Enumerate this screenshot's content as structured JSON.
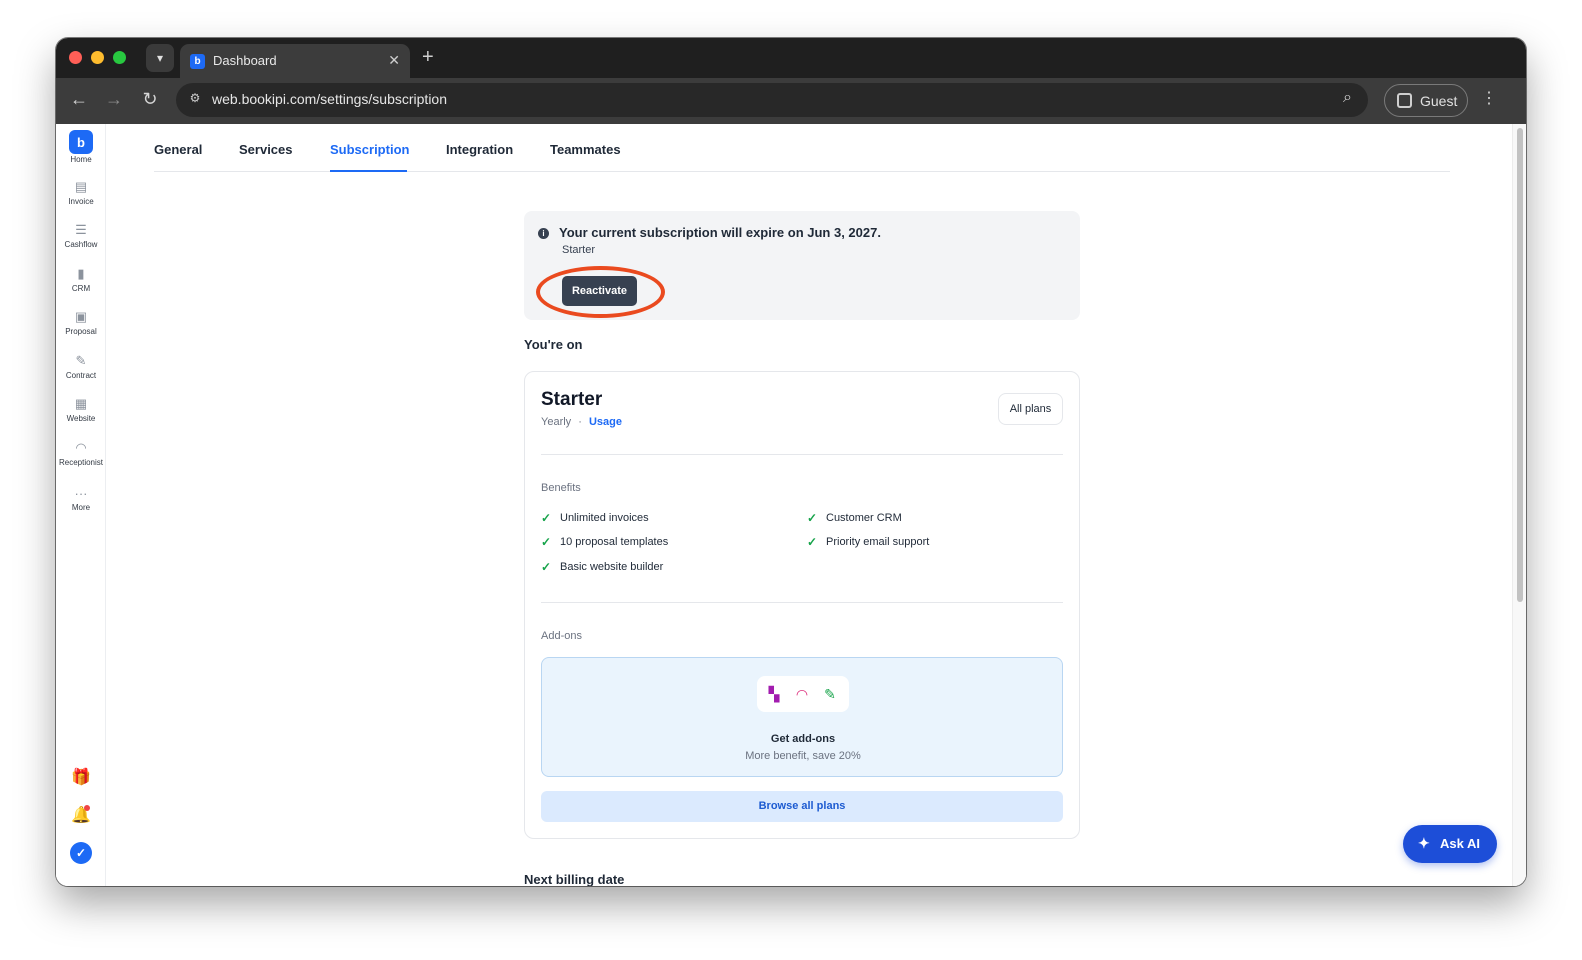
{
  "browser": {
    "tab_title": "Dashboard",
    "url": "web.bookipi.com/settings/subscription",
    "profile_label": "Guest"
  },
  "sidebar": {
    "items": [
      {
        "label": "Home",
        "icon": "bookipi-logo-icon"
      },
      {
        "label": "Invoice",
        "icon": "invoice-icon"
      },
      {
        "label": "Cashflow",
        "icon": "cashflow-icon"
      },
      {
        "label": "CRM",
        "icon": "crm-icon"
      },
      {
        "label": "Proposal",
        "icon": "proposal-icon"
      },
      {
        "label": "Contract",
        "icon": "contract-icon"
      },
      {
        "label": "Website",
        "icon": "website-icon"
      },
      {
        "label": "Receptionist",
        "icon": "headset-icon"
      },
      {
        "label": "More",
        "icon": "more-icon"
      }
    ]
  },
  "settings_tabs": [
    "General",
    "Services",
    "Subscription",
    "Integration",
    "Teammates"
  ],
  "active_tab": "Subscription",
  "alert": {
    "title": "Your current subscription will expire on Jun 3, 2027.",
    "plan": "Starter",
    "button": "Reactivate"
  },
  "current_plan": {
    "heading": "You're on",
    "name": "Starter",
    "billing": "Yearly",
    "separator": "·",
    "usage_link": "Usage",
    "all_plans_button": "All plans",
    "benefits_label": "Benefits",
    "benefits": [
      "Unlimited invoices",
      "Customer CRM",
      "10 proposal templates",
      "Priority email support",
      "Basic website builder"
    ],
    "addons_label": "Add-ons",
    "addons_title": "Get add-ons",
    "addons_subtitle": "More benefit, save 20%",
    "browse_button": "Browse all plans"
  },
  "next_billing_heading": "Next billing date",
  "ask_ai_label": "Ask AI",
  "colors": {
    "accent": "#1d6af5",
    "highlight_ring": "#ea4a1f",
    "check": "#16a34a"
  }
}
